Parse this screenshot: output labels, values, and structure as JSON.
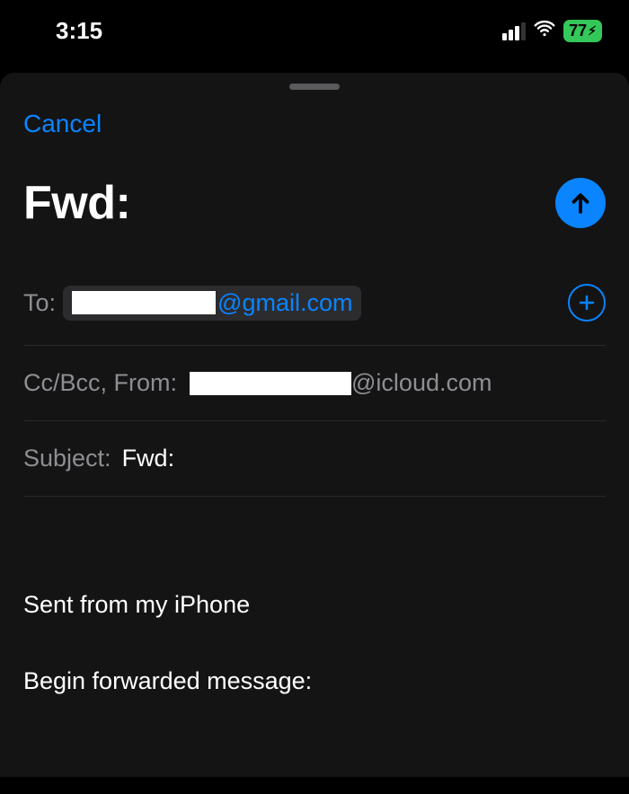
{
  "statusBar": {
    "time": "3:15",
    "batteryPercent": "77",
    "batteryCharging": true
  },
  "header": {
    "cancel": "Cancel",
    "title": "Fwd:"
  },
  "fields": {
    "toLabel": "To:",
    "toSuffix": "@gmail.com",
    "ccBccFromLabel": "Cc/Bcc, From:",
    "fromSuffix": "@icloud.com",
    "subjectLabel": "Subject:",
    "subjectValue": "Fwd:"
  },
  "body": {
    "signature": "Sent from my iPhone",
    "forwardHeader": "Begin forwarded message:"
  },
  "icons": {
    "send": "arrow-up-icon",
    "add": "plus-icon",
    "wifi": "wifi-icon",
    "cellular": "cellular-icon",
    "battery": "battery-icon"
  }
}
